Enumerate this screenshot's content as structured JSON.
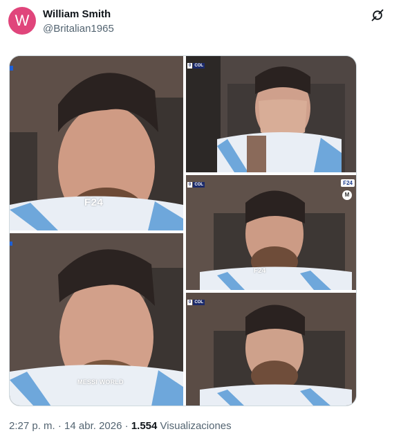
{
  "author": {
    "avatar_letter": "W",
    "avatar_color": "#e0457b",
    "display_name": "William Smith",
    "handle": "@Britalian1965"
  },
  "header": {
    "action_icon": "grok-icon"
  },
  "media": {
    "photos": [
      {
        "id": "photo-1",
        "watermark": "F24"
      },
      {
        "id": "photo-2",
        "watermark": "MESSI WORLD"
      },
      {
        "id": "photo-3",
        "watermark": ""
      },
      {
        "id": "photo-4",
        "watermark": "F24",
        "badge": "F24",
        "logo": "M"
      },
      {
        "id": "photo-5",
        "watermark": ""
      }
    ]
  },
  "meta": {
    "time": "2:27 p. m.",
    "separator": "·",
    "date": "14 abr. 2026",
    "views_count": "1.554",
    "views_label": "Visualizaciones"
  },
  "colors": {
    "text_primary": "#0f1419",
    "text_secondary": "#536471",
    "border": "#cfd9de"
  }
}
